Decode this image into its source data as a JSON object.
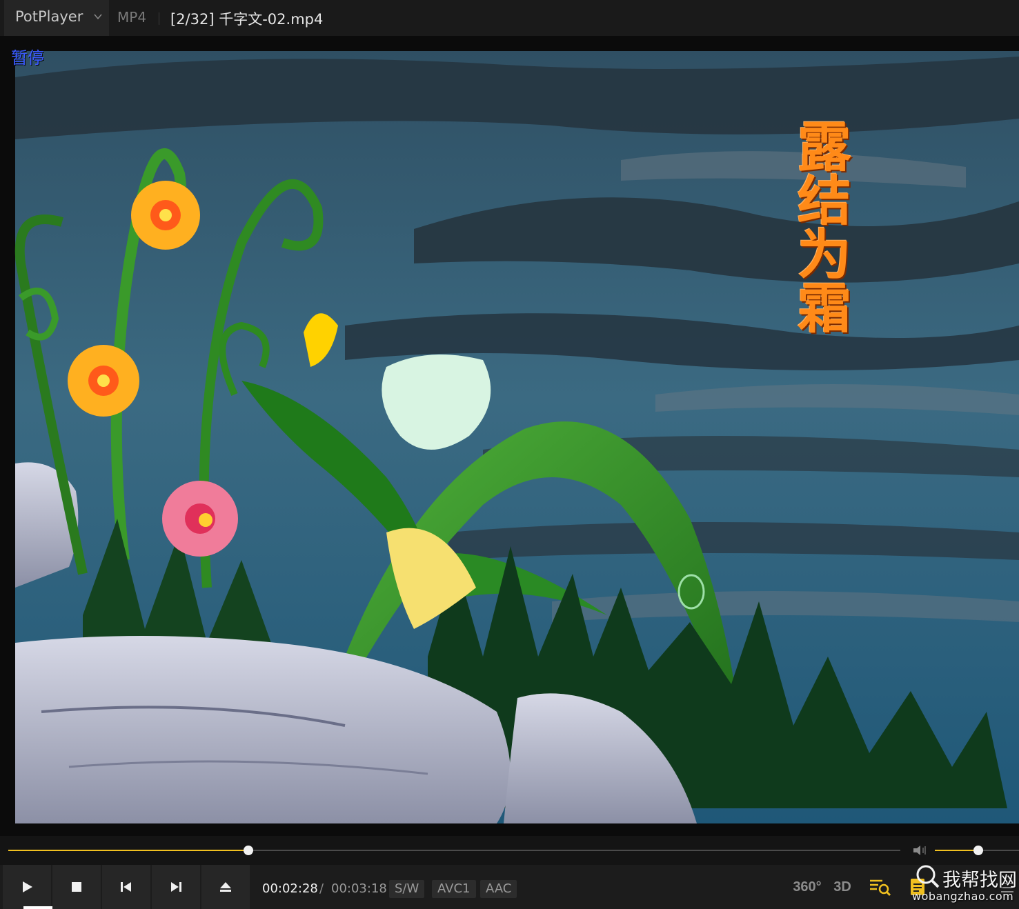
{
  "titlebar": {
    "app_name": "PotPlayer",
    "format": "MP4",
    "file_title": "[2/32] 千字文-02.mp4"
  },
  "video": {
    "osd_status": "暂停",
    "caption": "露结为霜"
  },
  "playback": {
    "progress_fraction": 0.269,
    "volume_fraction": 0.52,
    "current_time": "00:02:28",
    "separator": "/",
    "total_time": "00:03:18"
  },
  "codec_tags": {
    "render": "S/W",
    "video_codec": "AVC1",
    "audio_codec": "AAC"
  },
  "right_tools": {
    "vr_label": "360°",
    "threed_label": "3D"
  },
  "watermark": {
    "cn": "我帮找网",
    "en": "wobangzhao.com"
  },
  "colors": {
    "accent": "#f0c020",
    "osd": "#3a5bff",
    "caption": "#ff8a18",
    "background": "#1c1c1c"
  }
}
